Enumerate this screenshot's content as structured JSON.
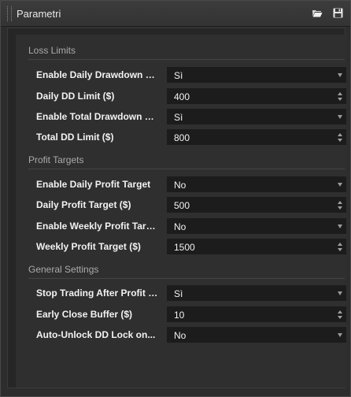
{
  "window": {
    "title": "Parametri",
    "icons": [
      "open-folder-icon",
      "save-icon"
    ]
  },
  "sections": {
    "loss_limits": {
      "title": "Loss Limits",
      "rows": [
        {
          "label": "Enable Daily Drawdown L...",
          "value": "Sì",
          "type": "dropdown"
        },
        {
          "label": "Daily DD Limit ($)",
          "value": "400",
          "type": "spinner"
        },
        {
          "label": "Enable Total Drawdown Li...",
          "value": "Sì",
          "type": "dropdown"
        },
        {
          "label": "Total DD Limit ($)",
          "value": "800",
          "type": "spinner"
        }
      ]
    },
    "profit_targets": {
      "title": "Profit Targets",
      "rows": [
        {
          "label": "Enable Daily Profit Target",
          "value": "No",
          "type": "dropdown"
        },
        {
          "label": "Daily Profit Target ($)",
          "value": "500",
          "type": "spinner"
        },
        {
          "label": "Enable Weekly Profit Target",
          "value": "No",
          "type": "dropdown"
        },
        {
          "label": "Weekly Profit Target ($)",
          "value": "1500",
          "type": "spinner"
        }
      ]
    },
    "general_settings": {
      "title": "General Settings",
      "rows": [
        {
          "label": "Stop Trading After Profit T...",
          "value": "Sì",
          "type": "dropdown"
        },
        {
          "label": "Early Close Buffer ($)",
          "value": "10",
          "type": "spinner"
        },
        {
          "label": "Auto-Unlock DD Lock on...",
          "value": "No",
          "type": "dropdown"
        }
      ]
    }
  }
}
